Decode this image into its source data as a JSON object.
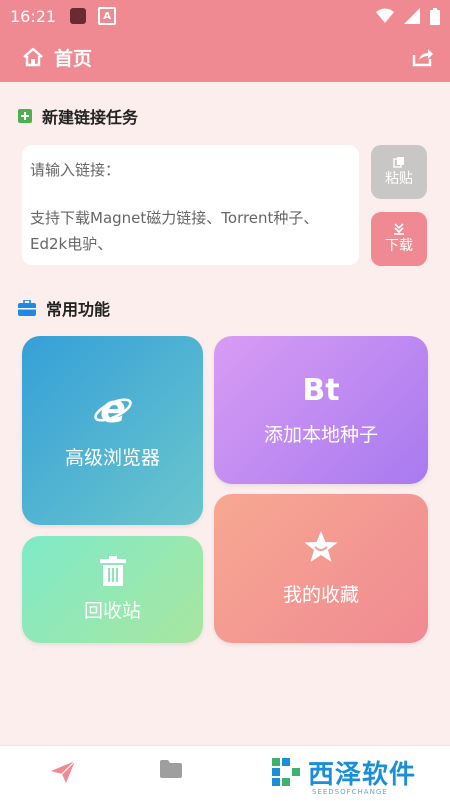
{
  "status": {
    "time": "16:21"
  },
  "header": {
    "title": "首页"
  },
  "new_task": {
    "title": "新建链接任务",
    "placeholder": "请输入链接：",
    "hint": "支持下载Magnet磁力链接、Torrent种子、Ed2k电驴、",
    "paste_label": "粘贴",
    "download_label": "下载"
  },
  "functions": {
    "title": "常用功能",
    "cards": [
      {
        "label": "高级浏览器",
        "icon": "ie-icon"
      },
      {
        "label": "添加本地种子",
        "icon": "bt-icon",
        "icon_text": "Bt"
      },
      {
        "label": "回收站",
        "icon": "trash-icon"
      },
      {
        "label": "我的收藏",
        "icon": "star-icon"
      }
    ]
  },
  "watermark": {
    "name": "西泽软件",
    "sub": "SEEDSOFCHANGE"
  },
  "colors": {
    "accent": "#f08a92",
    "background": "#fdeeee"
  }
}
